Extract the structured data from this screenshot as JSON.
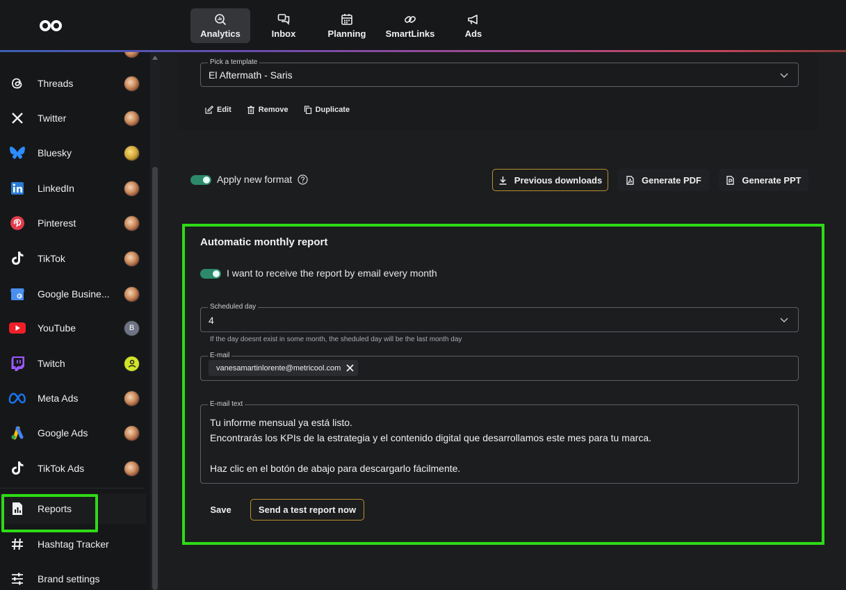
{
  "nav": {
    "items": [
      {
        "label": "Analytics",
        "icon": "analytics-search-icon",
        "active": true
      },
      {
        "label": "Inbox",
        "icon": "chat-bubbles-icon",
        "active": false
      },
      {
        "label": "Planning",
        "icon": "calendar-icon",
        "active": false
      },
      {
        "label": "SmartLinks",
        "icon": "link-icon",
        "active": false
      },
      {
        "label": "Ads",
        "icon": "megaphone-icon",
        "active": false
      }
    ]
  },
  "sidebar": {
    "items": [
      {
        "label": "Threads",
        "icon": "threads-icon"
      },
      {
        "label": "Twitter",
        "icon": "x-icon"
      },
      {
        "label": "Bluesky",
        "icon": "bluesky-icon"
      },
      {
        "label": "LinkedIn",
        "icon": "linkedin-icon"
      },
      {
        "label": "Pinterest",
        "icon": "pinterest-icon"
      },
      {
        "label": "TikTok",
        "icon": "tiktok-icon"
      },
      {
        "label": "Google Busine...",
        "icon": "google-business-icon"
      },
      {
        "label": "YouTube",
        "icon": "youtube-icon",
        "avatar_text": "B"
      },
      {
        "label": "Twitch",
        "icon": "twitch-icon"
      },
      {
        "label": "Meta Ads",
        "icon": "meta-icon"
      },
      {
        "label": "Google Ads",
        "icon": "google-ads-icon"
      },
      {
        "label": "TikTok Ads",
        "icon": "tiktok-icon"
      },
      {
        "label": "Reports",
        "icon": "report-icon"
      },
      {
        "label": "Hashtag Tracker",
        "icon": "hashtag-icon"
      },
      {
        "label": "Brand settings",
        "icon": "sliders-icon"
      }
    ]
  },
  "template": {
    "legend": "Pick a template",
    "value": "El Aftermath - Saris",
    "actions": {
      "edit": "Edit",
      "remove": "Remove",
      "duplicate": "Duplicate"
    }
  },
  "format": {
    "label": "Apply new format",
    "enabled": true
  },
  "buttons": {
    "previous_downloads": "Previous downloads",
    "generate_pdf": "Generate PDF",
    "generate_ppt": "Generate PPT"
  },
  "monthly": {
    "title": "Automatic monthly report",
    "toggle_label": "I want to receive the report by email every month",
    "toggle_enabled": true,
    "scheduled_day": {
      "legend": "Scheduled day",
      "value": "4",
      "helper": "If the day doesnt exist in some month, the sheduled day will be the last month day"
    },
    "email": {
      "legend": "E-mail",
      "chip": "vanesamartinlorente@metricool.com"
    },
    "email_text": {
      "legend": "E-mail text",
      "lines": [
        "Tu informe mensual ya está listo.",
        "Encontrarás los KPIs de la estrategia y el contenido digital que desarrollamos este mes para tu marca.",
        "",
        "Haz clic en el botón de abajo para descargarlo fácilmente."
      ]
    },
    "save": "Save",
    "send_test": "Send a test report now"
  },
  "colors": {
    "accent_green": "#2edb16",
    "toggle_green": "#2c8a6a",
    "outline_gold": "#b9902f"
  }
}
